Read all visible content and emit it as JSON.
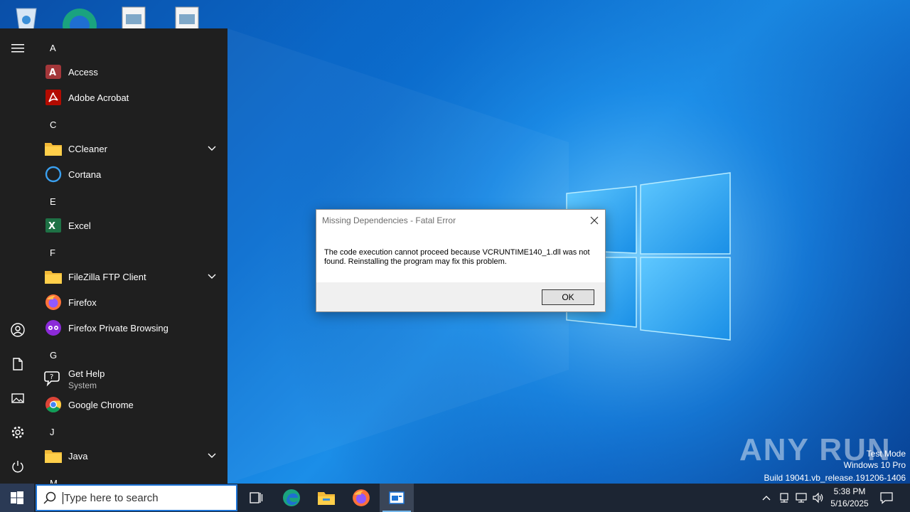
{
  "desktop": {
    "icons": [
      "recycle-bin",
      "edge",
      "document",
      "document"
    ]
  },
  "start_menu": {
    "rail": [
      "hamburger-menu",
      "user",
      "documents",
      "pictures",
      "settings",
      "power"
    ],
    "groups": [
      {
        "letter": "A",
        "apps": [
          {
            "label": "Access",
            "icon": "access-icon"
          },
          {
            "label": "Adobe Acrobat",
            "icon": "acrobat-icon"
          }
        ]
      },
      {
        "letter": "C",
        "apps": [
          {
            "label": "CCleaner",
            "icon": "folder-icon",
            "expandable": true
          },
          {
            "label": "Cortana",
            "icon": "cortana-icon"
          }
        ]
      },
      {
        "letter": "E",
        "apps": [
          {
            "label": "Excel",
            "icon": "excel-icon"
          }
        ]
      },
      {
        "letter": "F",
        "apps": [
          {
            "label": "FileZilla FTP Client",
            "icon": "folder-icon",
            "expandable": true
          },
          {
            "label": "Firefox",
            "icon": "firefox-icon"
          },
          {
            "label": "Firefox Private Browsing",
            "icon": "firefox-private-icon"
          }
        ]
      },
      {
        "letter": "G",
        "apps": [
          {
            "label": "Get Help",
            "sublabel": "System",
            "icon": "get-help-icon"
          },
          {
            "label": "Google Chrome",
            "icon": "chrome-icon"
          }
        ]
      },
      {
        "letter": "J",
        "apps": [
          {
            "label": "Java",
            "icon": "folder-icon",
            "expandable": true
          }
        ]
      },
      {
        "letter": "M",
        "apps": []
      }
    ]
  },
  "dialog": {
    "title": "Missing Dependencies - Fatal Error",
    "message": "The code execution cannot proceed because VCRUNTIME140_1.dll was not found. Reinstalling the program may fix this problem.",
    "ok_label": "OK"
  },
  "watermark": {
    "logo": "ANY RUN",
    "lines": [
      "Test Mode",
      "Windows 10 Pro",
      "Build 19041.vb_release.191206-1406"
    ]
  },
  "taskbar": {
    "search_placeholder": "Type here to search",
    "pinned": [
      "task-view",
      "edge",
      "file-explorer",
      "firefox",
      "active-app"
    ],
    "tray": [
      "chevron-up",
      "network-drive",
      "network",
      "volume",
      "notifications"
    ],
    "time": "5:38 PM",
    "date": "5/16/2025"
  },
  "colors": {
    "start_menu_bg": "#1f1f1f",
    "taskbar_bg": "#1c2533",
    "accent": "#1d74d6",
    "dialog_footer": "#f0f0f0"
  }
}
